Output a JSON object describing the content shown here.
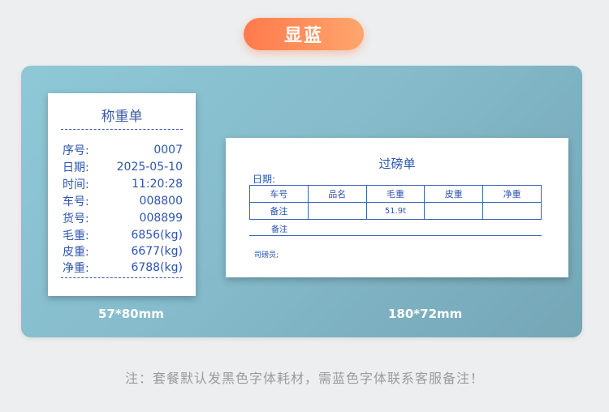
{
  "header": {
    "badge_label": "显蓝"
  },
  "receipt_57": {
    "title": "称重单",
    "rows": [
      {
        "label": "序号:",
        "value": "0007"
      },
      {
        "label": "日期:",
        "value": "2025-05-10"
      },
      {
        "label": "时间:",
        "value": "11:20:28"
      },
      {
        "label": "车号:",
        "value": "008800"
      },
      {
        "label": "货号:",
        "value": "008899"
      },
      {
        "label": "毛重:",
        "value": "6856(kg)"
      },
      {
        "label": "皮重:",
        "value": "6677(kg)"
      },
      {
        "label": "净重:",
        "value": "6788(kg)"
      }
    ],
    "size_label": "57*80mm"
  },
  "ticket_180": {
    "title": "过磅单",
    "date_label": "日期:",
    "columns": [
      "车号",
      "品名",
      "毛重",
      "皮重",
      "净重"
    ],
    "row": [
      "备注",
      "",
      "51.9t",
      "",
      ""
    ],
    "remark_label": "备注",
    "weigher_label": "司磅员;",
    "size_label": "180*72mm"
  },
  "footer": {
    "note": "注：套餐默认发黑色字体耗材，需蓝色字体联系客服备注！"
  },
  "colors": {
    "badge": "#ff8a56",
    "panel": "#86bccc",
    "ink": "#2c54b0"
  }
}
